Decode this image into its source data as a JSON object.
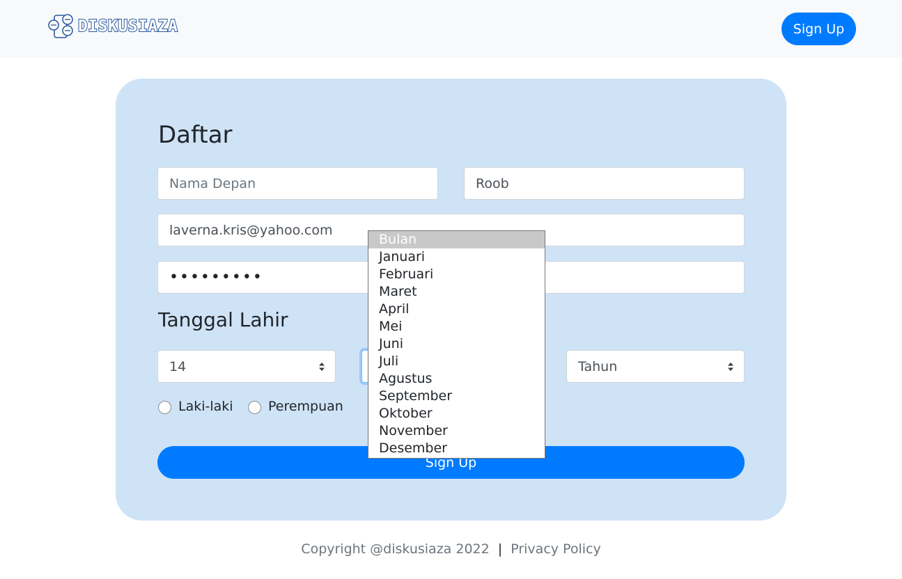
{
  "brand": {
    "name": "DISKUSIAZA",
    "logo_icon": "chat-bubbles-icon",
    "color": "#2c5aa0"
  },
  "nav": {
    "signup_label": "Sign Up"
  },
  "form": {
    "title": "Daftar",
    "first_name": {
      "placeholder": "Nama Depan",
      "value": ""
    },
    "last_name": {
      "value": "Roob"
    },
    "email": {
      "value": "laverna.kris@yahoo.com"
    },
    "password": {
      "masked": "•••••••••"
    },
    "dob_title": "Tanggal Lahir",
    "day": {
      "value": "14"
    },
    "month": {
      "options": [
        "Bulan",
        "Januari",
        "Februari",
        "Maret",
        "April",
        "Mei",
        "Juni",
        "Juli",
        "Agustus",
        "September",
        "Oktober",
        "November",
        "Desember"
      ],
      "highlighted": "Bulan"
    },
    "year": {
      "value": "Tahun"
    },
    "gender": {
      "male_label": "Laki-laki",
      "female_label": "Perempuan"
    },
    "submit_label": "Sign Up"
  },
  "footer": {
    "copyright": "Copyright @diskusiaza 2022",
    "separator": "|",
    "privacy": "Privacy Policy"
  },
  "colors": {
    "primary": "#007bff",
    "card_bg": "#cfe3f7",
    "navbar_bg": "#f8f9fa"
  }
}
